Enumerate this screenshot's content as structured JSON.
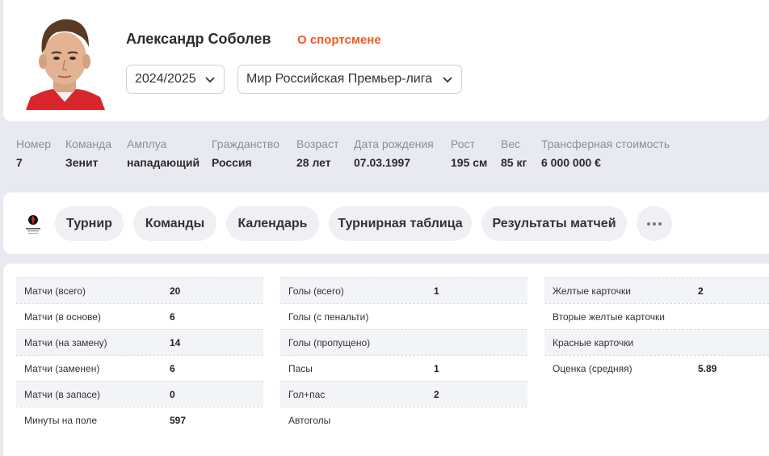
{
  "player": {
    "name": "Александр Соболев",
    "about_link": "О спортсмене",
    "avatar_icon": "player-photo"
  },
  "filters": {
    "season": "2024/2025",
    "league": "Мир Российская Премьер-лига"
  },
  "stats": [
    {
      "key": "Номер",
      "value": "7"
    },
    {
      "key": "Команда",
      "value": "Зенит"
    },
    {
      "key": "Амплуа",
      "value": "нападающий"
    },
    {
      "key": "Гражданство",
      "value": "Россия"
    },
    {
      "key": "Возраст",
      "value": "28 лет"
    },
    {
      "key": "Дата рождения",
      "value": "07.03.1997"
    },
    {
      "key": "Рост",
      "value": "195 см"
    },
    {
      "key": "Вес",
      "value": "85 кг"
    },
    {
      "key": "Трансферная стоимость",
      "value": "6 000 000 €"
    }
  ],
  "nav": {
    "logo_icon": "rpl-logo-icon",
    "items": [
      "Турнир",
      "Команды",
      "Календарь",
      "Турнирная таблица",
      "Результаты матчей"
    ],
    "more_icon": "more-dots-icon"
  },
  "tables": {
    "col1": [
      {
        "label": "Матчи (всего)",
        "value": "20"
      },
      {
        "label": "Матчи (в основе)",
        "value": "6"
      },
      {
        "label": "Матчи (на замену)",
        "value": "14"
      },
      {
        "label": "Матчи (заменен)",
        "value": "6"
      },
      {
        "label": "Матчи (в запасе)",
        "value": "0"
      },
      {
        "label": "Минуты на поле",
        "value": "597"
      }
    ],
    "col2": [
      {
        "label": "Голы (всего)",
        "value": "1"
      },
      {
        "label": "Голы (с пенальти)",
        "value": ""
      },
      {
        "label": "Голы (пропущено)",
        "value": ""
      },
      {
        "label": "Пасы",
        "value": "1"
      },
      {
        "label": "Гол+пас",
        "value": "2"
      },
      {
        "label": "Автоголы",
        "value": ""
      }
    ],
    "col3": [
      {
        "label": "Желтые карточки",
        "value": "2"
      },
      {
        "label": "Вторые желтые карточки",
        "value": ""
      },
      {
        "label": "Красные карточки",
        "value": ""
      },
      {
        "label": "Оценка (средняя)",
        "value": "5.89"
      }
    ]
  },
  "colors": {
    "accent": "#f05a22",
    "background": "#e9eaf1",
    "pill": "#eff0f3"
  }
}
